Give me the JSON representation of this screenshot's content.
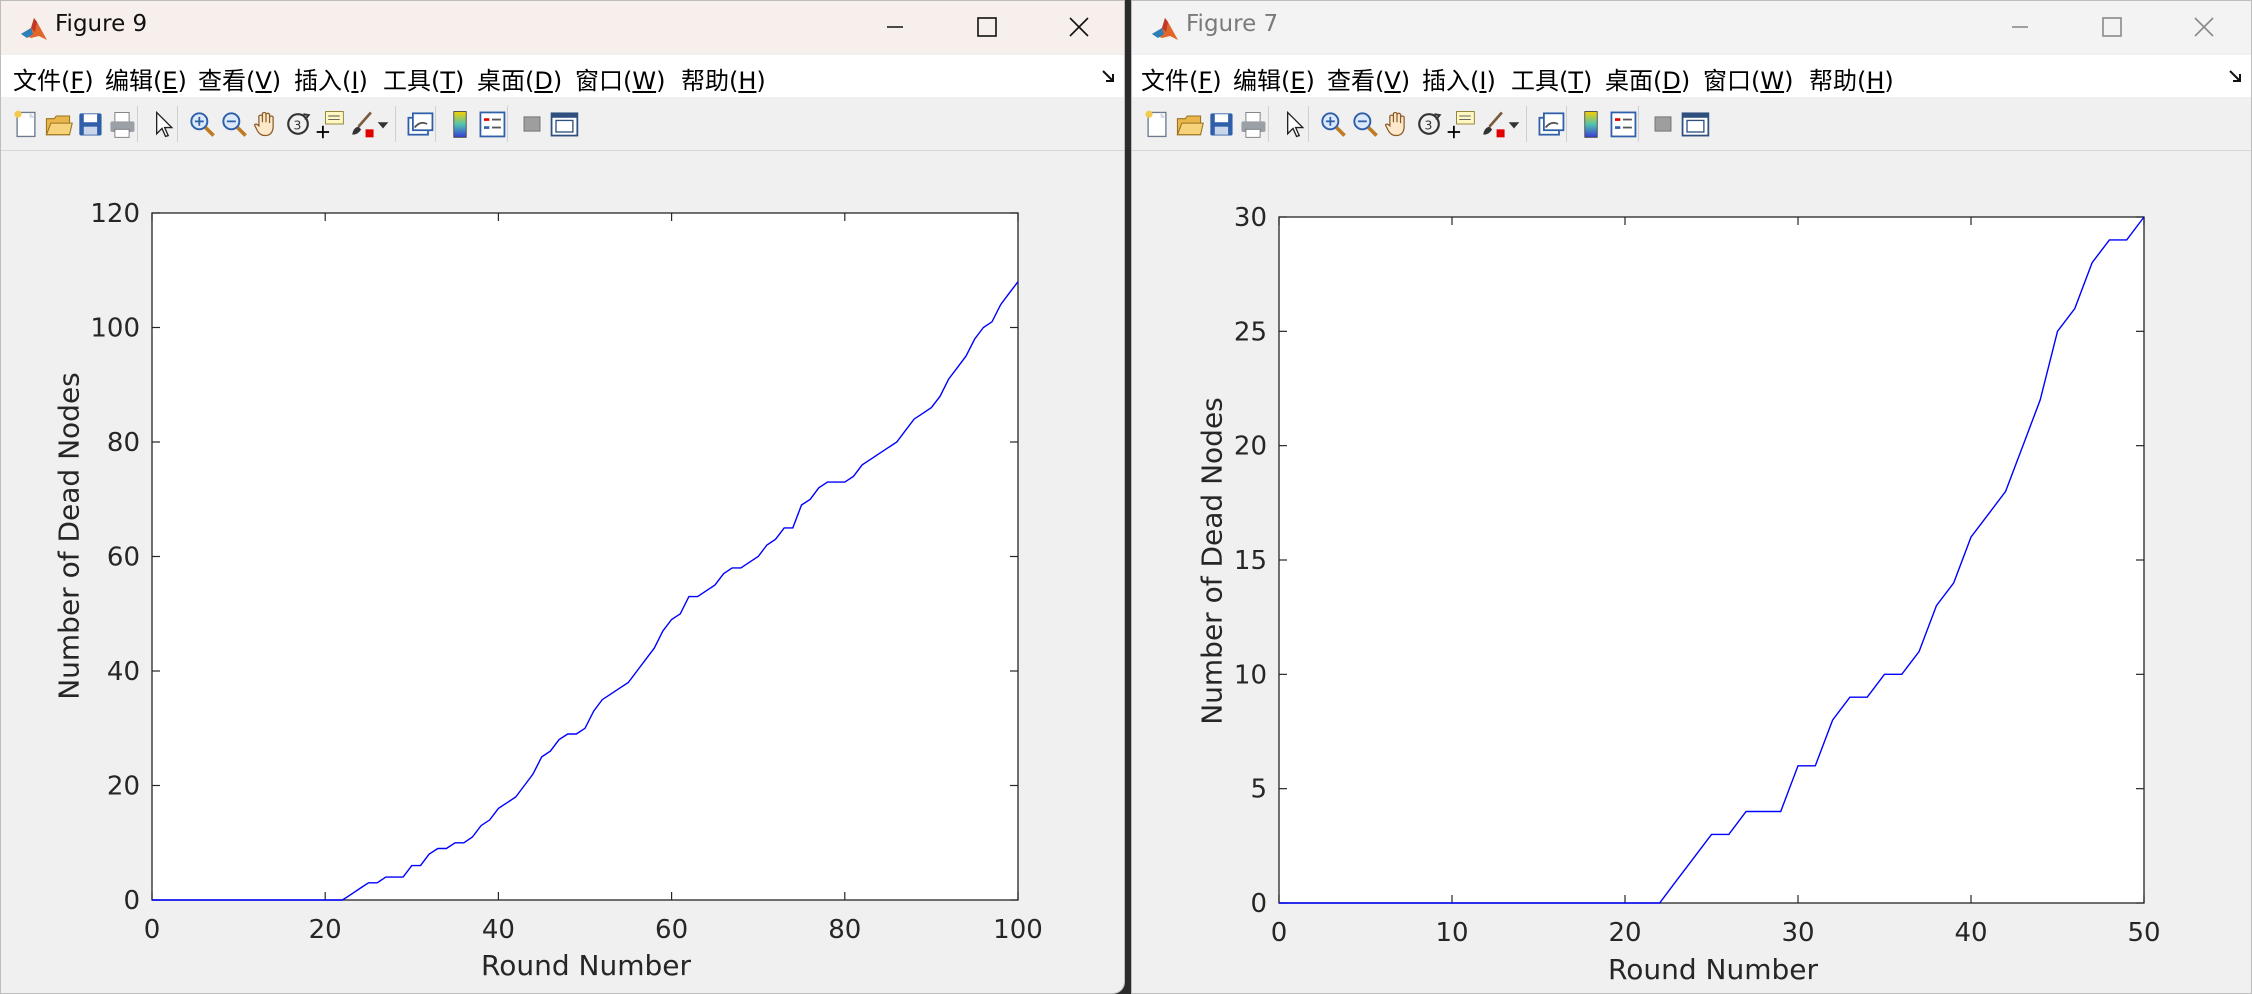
{
  "windows": [
    {
      "title": "Figure 9",
      "menu": [
        {
          "pre": "文件(",
          "u": "F",
          "post": ")"
        },
        {
          "pre": "编辑(",
          "u": "E",
          "post": ")"
        },
        {
          "pre": "查看(",
          "u": "V",
          "post": ")"
        },
        {
          "pre": "插入(",
          "u": "I",
          "post": ")"
        },
        {
          "pre": "工具(",
          "u": "T",
          "post": ")"
        },
        {
          "pre": "桌面(",
          "u": "D",
          "post": ")"
        },
        {
          "pre": "窗口(",
          "u": "W",
          "post": ")"
        },
        {
          "pre": "帮助(",
          "u": "H",
          "post": ")"
        }
      ],
      "toolbar_icons": [
        "new-figure-icon",
        "open-file-icon",
        "save-icon",
        "print-icon",
        "|",
        "pointer-icon",
        "|",
        "zoom-in-icon",
        "zoom-out-icon",
        "pan-hand-icon",
        "rotate-3d-icon",
        "data-cursor-icon",
        "brush-icon",
        "brush-dropdown-icon",
        "|",
        "link-plot-icon",
        "|",
        "colorbar-icon",
        "legend-icon",
        "|",
        "hide-plot-tools-icon",
        "show-plot-tools-icon"
      ]
    },
    {
      "title": "Figure 7",
      "menu": [
        {
          "pre": "文件(",
          "u": "F",
          "post": ")"
        },
        {
          "pre": "编辑(",
          "u": "E",
          "post": ")"
        },
        {
          "pre": "查看(",
          "u": "V",
          "post": ")"
        },
        {
          "pre": "插入(",
          "u": "I",
          "post": ")"
        },
        {
          "pre": "工具(",
          "u": "T",
          "post": ")"
        },
        {
          "pre": "桌面(",
          "u": "D",
          "post": ")"
        },
        {
          "pre": "窗口(",
          "u": "W",
          "post": ")"
        },
        {
          "pre": "帮助(",
          "u": "H",
          "post": ")"
        }
      ],
      "toolbar_icons": [
        "new-figure-icon",
        "open-file-icon",
        "save-icon",
        "print-icon",
        "|",
        "pointer-icon",
        "|",
        "zoom-in-icon",
        "zoom-out-icon",
        "pan-hand-icon",
        "rotate-3d-icon",
        "data-cursor-icon",
        "brush-icon",
        "brush-dropdown-icon",
        "|",
        "link-plot-icon",
        "|",
        "colorbar-icon",
        "legend-icon",
        "|",
        "hide-plot-tools-icon",
        "show-plot-tools-icon"
      ]
    }
  ],
  "chart_data": [
    {
      "type": "line",
      "title": "",
      "xlabel": "Round Number",
      "ylabel": "Number of Dead Nodes",
      "xlim": [
        0,
        100
      ],
      "ylim": [
        0,
        120
      ],
      "xticks": [
        0,
        20,
        40,
        60,
        80,
        100
      ],
      "yticks": [
        0,
        20,
        40,
        60,
        80,
        100,
        120
      ],
      "grid": false,
      "line_color": "#0000ff",
      "series": [
        {
          "x": [
            0,
            22,
            23,
            24,
            25,
            26,
            27,
            28,
            29,
            30,
            31,
            32,
            33,
            34,
            35,
            36,
            37,
            38,
            39,
            40,
            41,
            42,
            43,
            44,
            45,
            46,
            47,
            48,
            49,
            50,
            51,
            52,
            53,
            54,
            55,
            56,
            57,
            58,
            59,
            60,
            61,
            62,
            63,
            64,
            65,
            66,
            67,
            68,
            69,
            70,
            71,
            72,
            73,
            74,
            75,
            76,
            77,
            78,
            79,
            80,
            81,
            82,
            83,
            84,
            85,
            86,
            87,
            88,
            89,
            90,
            91,
            92,
            93,
            94,
            95,
            96,
            97,
            98,
            99,
            100
          ],
          "y": [
            0,
            0,
            1,
            2,
            3,
            3,
            4,
            4,
            4,
            6,
            6,
            8,
            9,
            9,
            10,
            10,
            11,
            13,
            14,
            16,
            17,
            18,
            20,
            22,
            25,
            26,
            28,
            29,
            29,
            30,
            33,
            35,
            36,
            37,
            38,
            40,
            42,
            44,
            47,
            49,
            50,
            53,
            53,
            54,
            55,
            57,
            58,
            58,
            59,
            60,
            62,
            63,
            65,
            65,
            69,
            70,
            72,
            73,
            73,
            73,
            74,
            76,
            77,
            78,
            79,
            80,
            82,
            84,
            85,
            86,
            88,
            91,
            93,
            95,
            98,
            100,
            101,
            104,
            106,
            108
          ]
        }
      ]
    },
    {
      "type": "line",
      "title": "",
      "xlabel": "Round Number",
      "ylabel": "Number of Dead Nodes",
      "xlim": [
        0,
        50
      ],
      "ylim": [
        0,
        30
      ],
      "xticks": [
        0,
        10,
        20,
        30,
        40,
        50
      ],
      "yticks": [
        0,
        5,
        10,
        15,
        20,
        25,
        30
      ],
      "grid": false,
      "line_color": "#0000ff",
      "series": [
        {
          "x": [
            0,
            22,
            23,
            24,
            25,
            26,
            27,
            28,
            29,
            30,
            31,
            32,
            33,
            34,
            35,
            36,
            37,
            38,
            39,
            40,
            41,
            42,
            43,
            44,
            45,
            46,
            47,
            48,
            49,
            50
          ],
          "y": [
            0,
            0,
            1,
            2,
            3,
            3,
            4,
            4,
            4,
            6,
            6,
            8,
            9,
            9,
            10,
            10,
            11,
            13,
            14,
            16,
            17,
            18,
            20,
            22,
            25,
            26,
            28,
            29,
            29,
            30
          ]
        }
      ]
    }
  ]
}
